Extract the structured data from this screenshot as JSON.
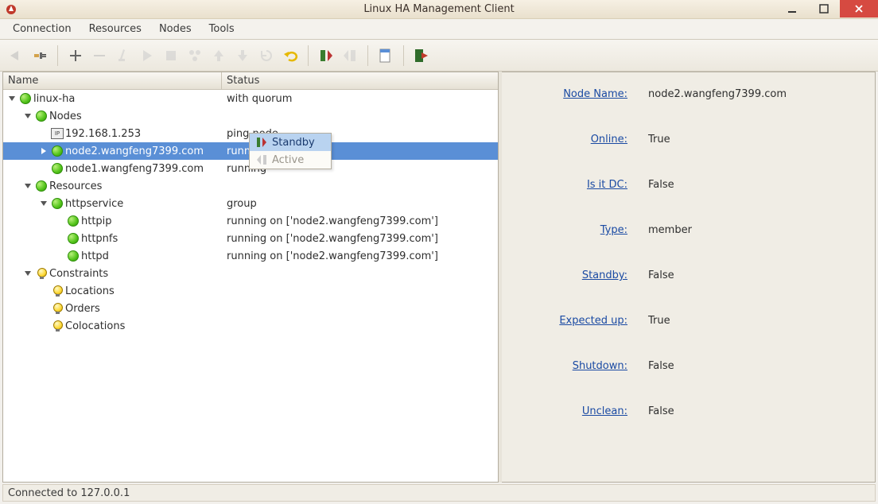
{
  "window": {
    "title": "Linux HA Management Client"
  },
  "menu": {
    "connection": "Connection",
    "resources": "Resources",
    "nodes": "Nodes",
    "tools": "Tools"
  },
  "tree": {
    "col_name": "Name",
    "col_status": "Status",
    "root": {
      "label": "linux-ha",
      "status": "with quorum"
    },
    "nodes_group": {
      "label": "Nodes"
    },
    "ping_node": {
      "label": "192.168.1.253",
      "status": "ping node"
    },
    "node2": {
      "label": "node2.wangfeng7399.com",
      "status": "running"
    },
    "node1": {
      "label": "node1.wangfeng7399.com",
      "status": "running"
    },
    "resources_group": {
      "label": "Resources"
    },
    "httpservice": {
      "label": "httpservice",
      "status": "group"
    },
    "httpip": {
      "label": "httpip",
      "status": "running on ['node2.wangfeng7399.com']"
    },
    "httpnfs": {
      "label": "httpnfs",
      "status": "running on ['node2.wangfeng7399.com']"
    },
    "httpd": {
      "label": "httpd",
      "status": "running on ['node2.wangfeng7399.com']"
    },
    "constraints": {
      "label": "Constraints"
    },
    "locations": {
      "label": "Locations"
    },
    "orders": {
      "label": "Orders"
    },
    "colocations": {
      "label": "Colocations"
    }
  },
  "context_menu": {
    "standby": "Standby",
    "active": "Active"
  },
  "details": {
    "labels": {
      "node_name": "Node Name:",
      "online": "Online:",
      "is_dc": "Is it DC:",
      "type": "Type:",
      "standby": "Standby:",
      "expected_up": "Expected up:",
      "shutdown": "Shutdown:",
      "unclean": "Unclean:"
    },
    "values": {
      "node_name": "node2.wangfeng7399.com",
      "online": "True",
      "is_dc": "False",
      "type": "member",
      "standby": "False",
      "expected_up": "True",
      "shutdown": "False",
      "unclean": "False"
    }
  },
  "statusbar": {
    "text": "Connected to 127.0.0.1"
  }
}
